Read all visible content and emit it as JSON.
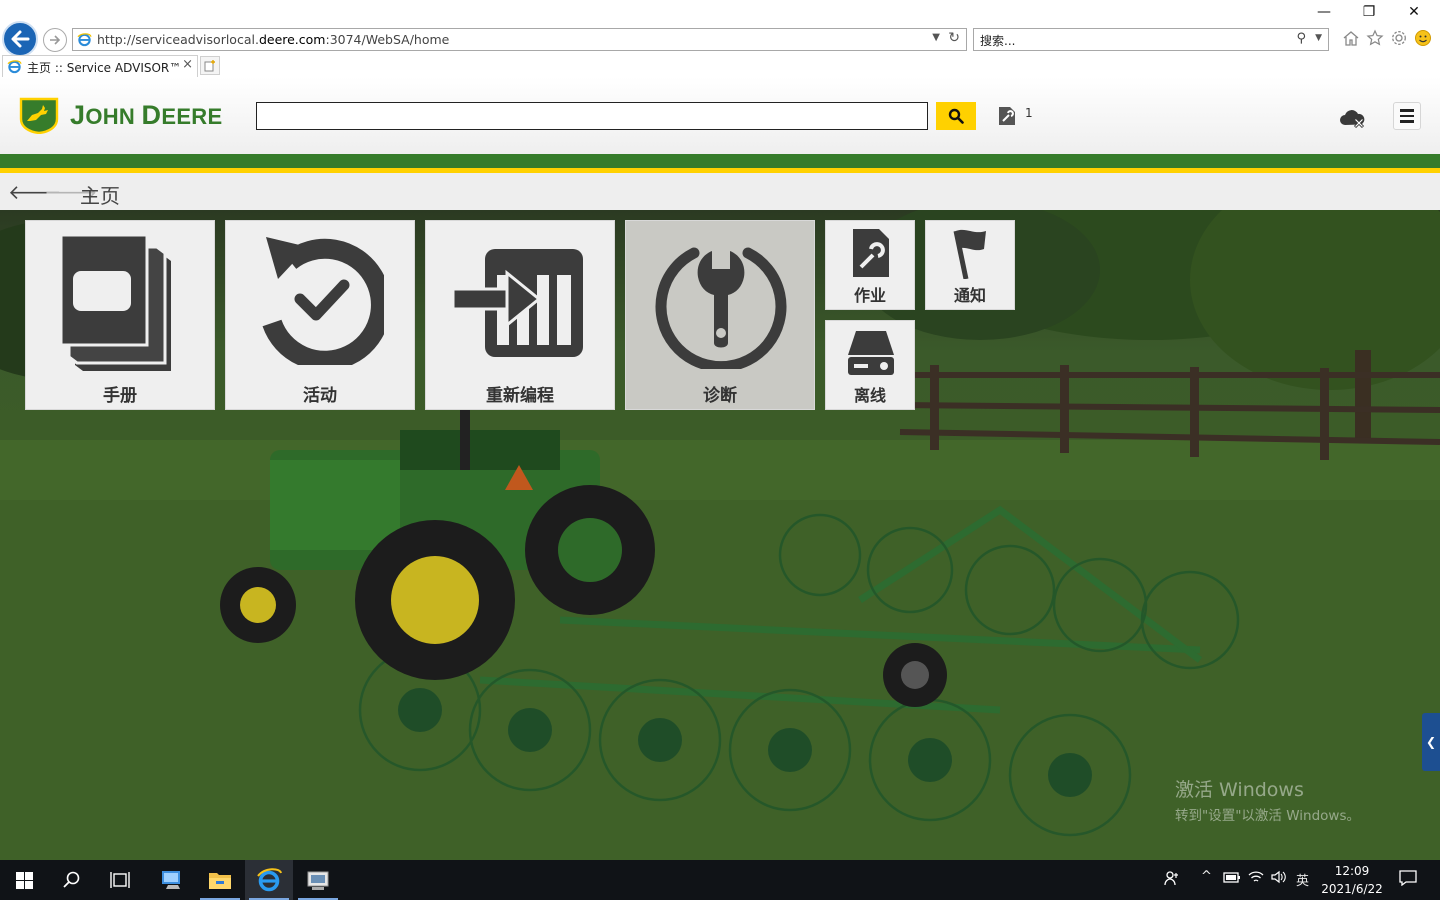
{
  "browser": {
    "url_prefix": "http://serviceadvisorlocal.",
    "url_domain": "deere.com",
    "url_suffix": ":3074/WebSA/home",
    "search_placeholder": "搜索...",
    "tab_title": "主页 :: Service ADVISOR™",
    "tab_close": "×",
    "window_controls": {
      "minimize": "—",
      "restore": "❐",
      "close": "✕"
    }
  },
  "header": {
    "brand_first_big": "J",
    "brand_first_rest": "OHN ",
    "brand_second_big": "D",
    "brand_second_rest": "EERE",
    "search_value": "",
    "jobs_count": "1",
    "colors": {
      "green": "#367c2b",
      "yellow": "#ffd100"
    }
  },
  "breadcrumb": {
    "back": "🡐",
    "forward": "🡒",
    "title": "主页"
  },
  "tiles": {
    "manual": {
      "label": "手册",
      "icon": "manual-icon"
    },
    "activity": {
      "label": "活动",
      "icon": "history-icon"
    },
    "reprogram": {
      "label": "重新编程",
      "icon": "reprogram-icon"
    },
    "diagnose": {
      "label": "诊断",
      "icon": "diagnostic-wrench-icon"
    },
    "jobs": {
      "label": "作业",
      "icon": "job-wrench-icon"
    },
    "notify": {
      "label": "通知",
      "icon": "flag-icon"
    },
    "offline": {
      "label": "离线",
      "icon": "drive-icon"
    }
  },
  "watermark": {
    "line1": "激活 Windows",
    "line2": "转到\"设置\"以激活 Windows。"
  },
  "side_handle": "❮",
  "taskbar": {
    "time": "12:09",
    "date": "2021/6/22",
    "ime": "英",
    "tray_up": "^"
  }
}
